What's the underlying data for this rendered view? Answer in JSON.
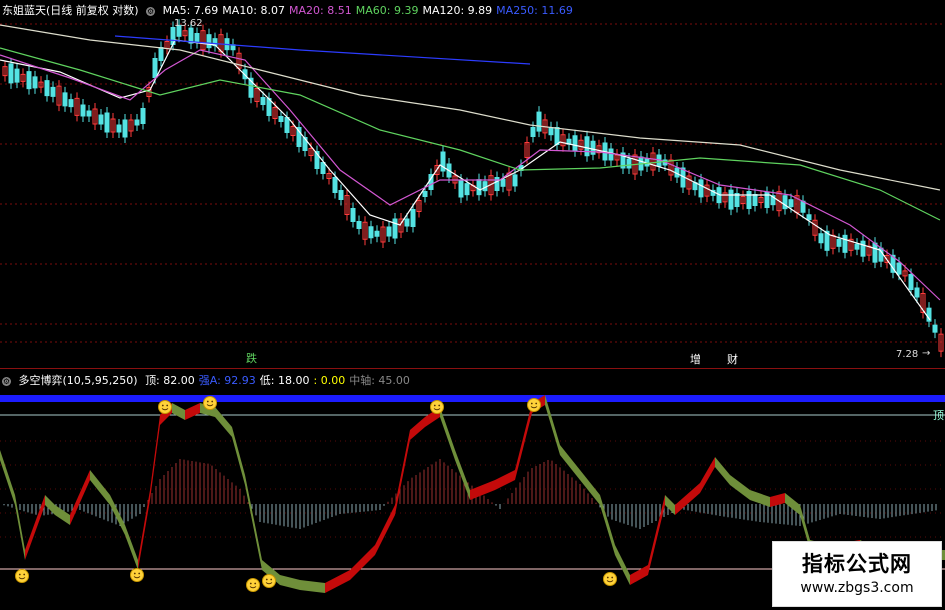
{
  "main_chart": {
    "title": "东姐蓝天(日线 前复权 对数)",
    "indicators": [
      {
        "label": "MA5: 7.69",
        "color": "#ffffff"
      },
      {
        "label": "MA10: 8.07",
        "color": "#ffffff"
      },
      {
        "label": "MA20: 8.51",
        "color": "#d257d2"
      },
      {
        "label": "MA60: 9.39",
        "color": "#5fd35f"
      },
      {
        "label": "MA120: 9.89",
        "color": "#ffffff"
      },
      {
        "label": "MA250: 11.69",
        "color": "#3a5bff"
      }
    ],
    "high_price_label": "13.62",
    "low_price_label": "7.28",
    "annotations": {
      "die": "跌",
      "zeng": "增",
      "cai": "财"
    }
  },
  "sub_chart": {
    "title": "多空博弈(10,5,95,250)",
    "indicators": [
      {
        "label": "顶: 82.00",
        "color": "#ffffff"
      },
      {
        "label": "强A: 92.93",
        "color": "#3a5bff"
      },
      {
        "label": "低: 18.00",
        "color": "#ffffff"
      },
      {
        "label": ": 0.00",
        "color": "#ffff00"
      },
      {
        "label": "中轴: 45.00",
        "color": "#888888"
      }
    ],
    "top_label": "顶"
  },
  "watermark": {
    "title": "指标公式网",
    "url": "www.zbgs3.com"
  },
  "colors": {
    "up": "#ff3b3b",
    "down": "#54e3e3",
    "grid": "#7a0c0c",
    "osc_up": "#c40a0a",
    "osc_down": "#6f8f3a"
  }
}
